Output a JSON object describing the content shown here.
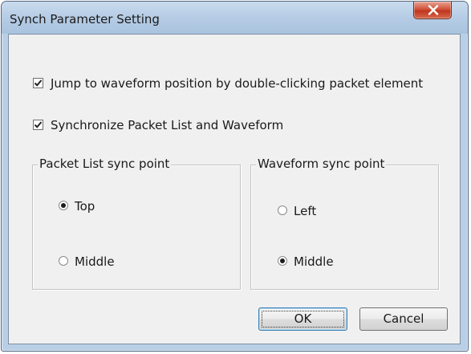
{
  "window": {
    "title": "Synch Parameter Setting"
  },
  "options": {
    "jump_label": "Jump to waveform position by double-clicking packet element",
    "jump_checked": true,
    "sync_label": "Synchronize Packet List and Waveform",
    "sync_checked": true
  },
  "packet_group": {
    "title": "Packet List sync point",
    "options": [
      {
        "label": "Top",
        "selected": true
      },
      {
        "label": "Middle",
        "selected": false
      }
    ]
  },
  "waveform_group": {
    "title": "Waveform sync point",
    "options": [
      {
        "label": "Left",
        "selected": false
      },
      {
        "label": "Middle",
        "selected": true
      }
    ]
  },
  "buttons": {
    "ok": "OK",
    "cancel": "Cancel"
  },
  "icons": {
    "close": "close-icon",
    "check": "checkmark-icon"
  }
}
